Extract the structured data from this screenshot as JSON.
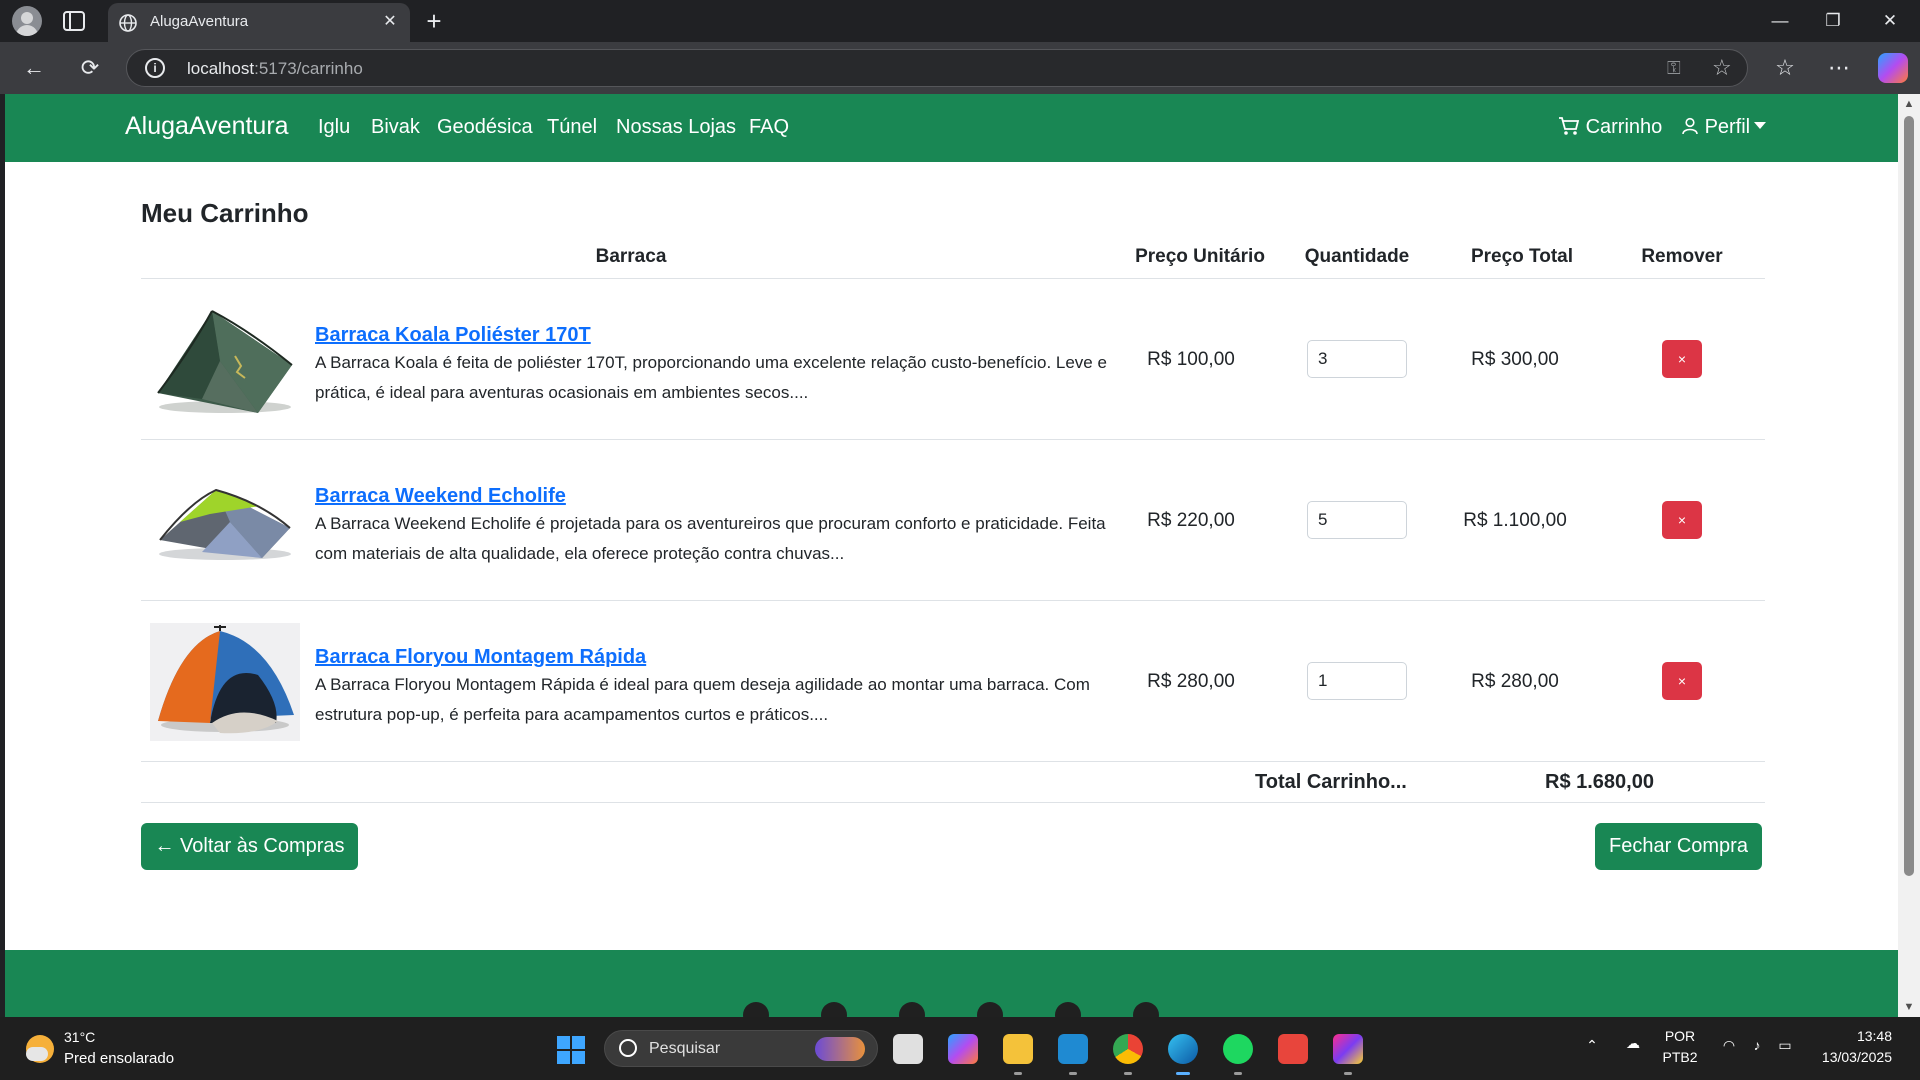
{
  "browser": {
    "tab_title": "AlugaAventura",
    "url_host": "localhost",
    "url_path": ":5173/carrinho"
  },
  "nav": {
    "brand": "AlugaAventura",
    "links": [
      "Iglu",
      "Bivak",
      "Geodésica",
      "Túnel",
      "Nossas Lojas",
      "FAQ"
    ],
    "cart": "Carrinho",
    "profile": "Perfil"
  },
  "cart": {
    "title": "Meu Carrinho",
    "headers": {
      "product": "Barraca",
      "unit_price": "Preço Unitário",
      "quantity": "Quantidade",
      "total_price": "Preço Total",
      "remove": "Remover"
    },
    "items": [
      {
        "name": "Barraca Koala Poliéster 170T",
        "description": "A Barraca Koala é feita de poliéster 170T, proporcionando uma excelente relação custo-benefício. Leve e prática, é ideal para aventuras ocasionais em ambientes secos....",
        "unit_price": "R$ 100,00",
        "quantity": "3",
        "total": "R$ 300,00",
        "remove": "×"
      },
      {
        "name": "Barraca Weekend Echolife",
        "description": "A Barraca Weekend Echolife é projetada para os aventureiros que procuram conforto e praticidade. Feita com materiais de alta qualidade, ela oferece proteção contra chuvas...",
        "unit_price": "R$ 220,00",
        "quantity": "5",
        "total": "R$ 1.100,00",
        "remove": "×"
      },
      {
        "name": "Barraca Floryou Montagem Rápida",
        "description": "A Barraca Floryou Montagem Rápida é ideal para quem deseja agilidade ao montar uma barraca. Com estrutura pop-up, é perfeita para acampamentos curtos e práticos....",
        "unit_price": "R$ 280,00",
        "quantity": "1",
        "total": "R$ 280,00",
        "remove": "×"
      }
    ],
    "total_label": "Total Carrinho...",
    "total_value": "R$ 1.680,00",
    "back_button": "← Voltar às Compras",
    "checkout_button": "Fechar Compra"
  },
  "footer": {
    "icons": [
      "facebook-icon",
      "twitter-icon",
      "google-icon",
      "instagram-icon",
      "linkedin-icon",
      "github-icon"
    ]
  },
  "taskbar": {
    "weather_temp": "31°C",
    "weather_desc": "Pred ensolarado",
    "search_placeholder": "Pesquisar",
    "lang_1": "POR",
    "lang_2": "PTB2",
    "time": "13:48",
    "date": "13/03/2025"
  },
  "colors": {
    "primary_green": "#198754",
    "link_blue": "#0d6efd",
    "danger_red": "#dc3545"
  }
}
